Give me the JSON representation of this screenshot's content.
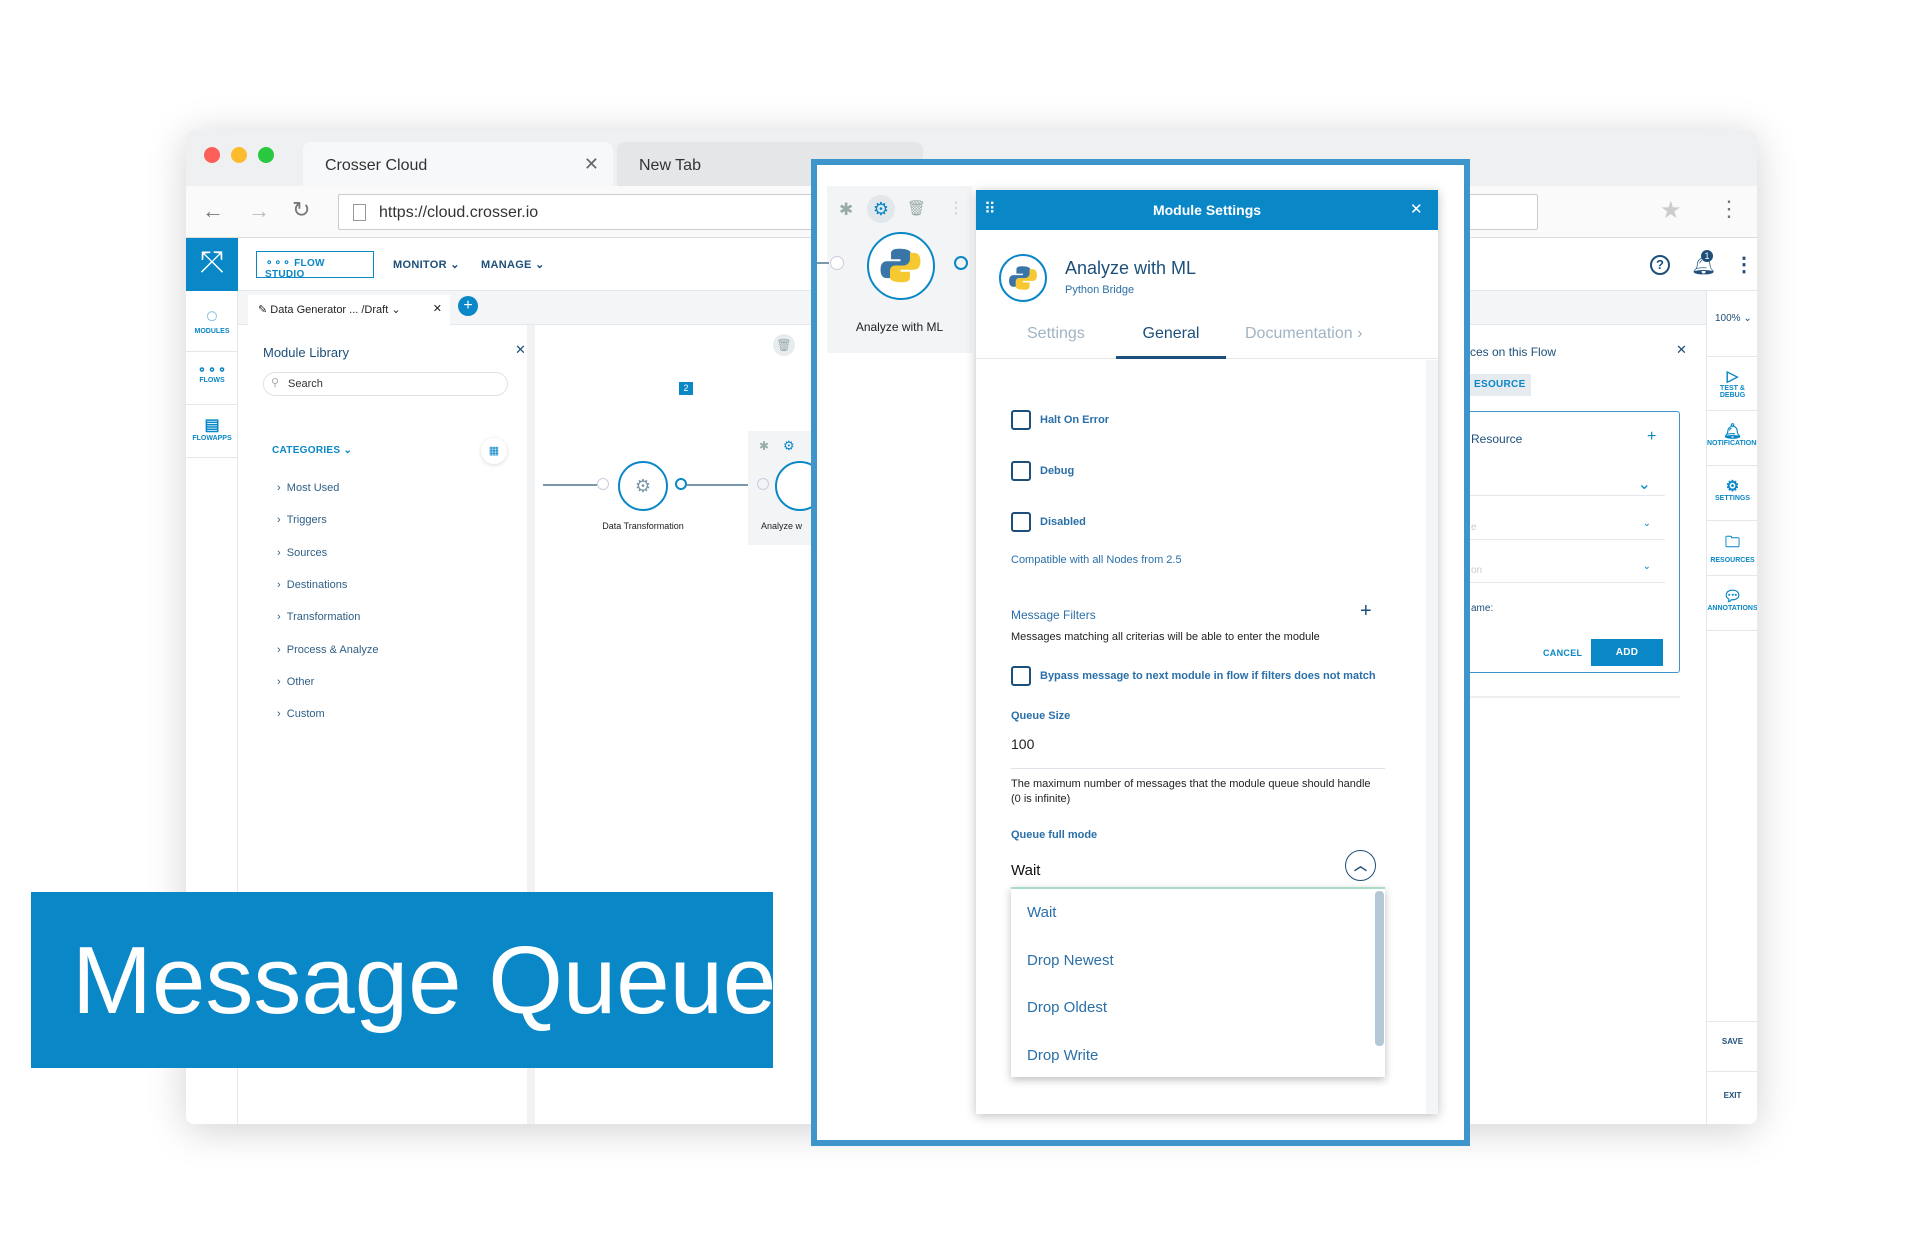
{
  "browser": {
    "tabs": [
      {
        "label": "Crosser Cloud"
      },
      {
        "label": "New Tab"
      }
    ],
    "url": "https://cloud.crosser.io"
  },
  "header": {
    "flow_studio": "FLOW STUDIO",
    "monitor": "MONITOR",
    "manage": "MANAGE",
    "notification_count": "1"
  },
  "left_rail": [
    {
      "label": "MODULES"
    },
    {
      "label": "FLOWS"
    },
    {
      "label": "FLOWAPPS"
    }
  ],
  "flow_tab": {
    "label": "Data Generator ... /Draft"
  },
  "module_library": {
    "title": "Module Library",
    "search_placeholder": "Search",
    "categories_label": "CATEGORIES",
    "items": [
      "Most Used",
      "Triggers",
      "Sources",
      "Destinations",
      "Transformation",
      "Process & Analyze",
      "Other",
      "Custom"
    ]
  },
  "canvas": {
    "comment_count": "2",
    "nodes": [
      {
        "label": "Data Transformation"
      },
      {
        "label": "Analyze w"
      }
    ],
    "selected_node": "Analyze with ML"
  },
  "resources_panel": {
    "title": "ces on this Flow",
    "tab": "ESOURCE",
    "card_title": "Resource",
    "field1": "e",
    "field2": "on",
    "field3": "ame:",
    "cancel": "CANCEL",
    "add": "ADD"
  },
  "right_rail": {
    "zoom": "100%",
    "items": [
      "TEST & DEBUG",
      "NOTIFICATIONS",
      "SETTINGS",
      "RESOURCES",
      "ANNOTATIONS"
    ],
    "save": "SAVE",
    "exit": "EXIT"
  },
  "modal": {
    "title": "Module Settings",
    "module_name": "Analyze with ML",
    "module_type": "Python Bridge",
    "tabs": [
      {
        "label": "Settings",
        "active": false
      },
      {
        "label": "General",
        "active": true
      },
      {
        "label": "Documentation",
        "active": false
      }
    ],
    "checkboxes": [
      {
        "label": "Halt On Error",
        "checked": false
      },
      {
        "label": "Debug",
        "checked": false
      },
      {
        "label": "Disabled",
        "checked": false
      }
    ],
    "compat": "Compatible with all Nodes from 2.5",
    "filters_title": "Message Filters",
    "filters_desc": "Messages matching all criterias will be able to enter the module",
    "bypass": {
      "label": "Bypass message to next module in flow if filters does not match",
      "checked": false
    },
    "queue_size_label": "Queue Size",
    "queue_size": "100",
    "queue_help": "The maximum number of messages that the module queue should handle (0 is infinite)",
    "queue_mode_label": "Queue full mode",
    "queue_mode": "Wait",
    "options": [
      "Wait",
      "Drop Newest",
      "Drop Oldest",
      "Drop Write"
    ]
  },
  "banner": {
    "text": "Message Queue"
  },
  "colors": {
    "primary": "#0a87c6",
    "text": "#1d4f7a",
    "frame": "#3d95cc"
  }
}
